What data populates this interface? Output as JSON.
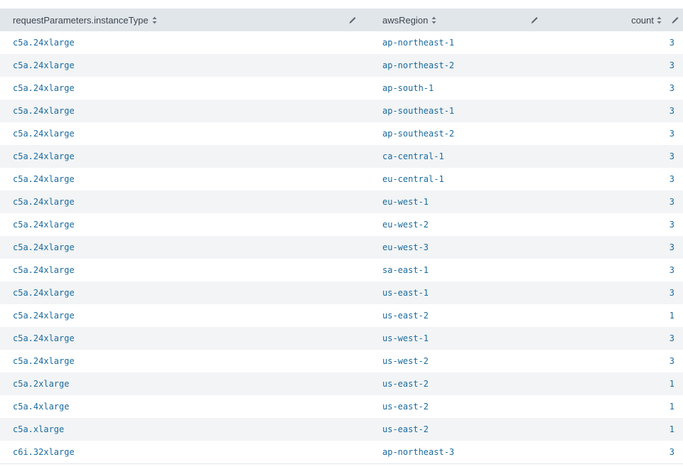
{
  "table": {
    "columns": [
      {
        "label": "requestParameters.instanceType"
      },
      {
        "label": "awsRegion"
      },
      {
        "label": "count"
      }
    ],
    "rows": [
      {
        "instanceType": "c5a.24xlarge",
        "awsRegion": "ap-northeast-1",
        "count": "3"
      },
      {
        "instanceType": "c5a.24xlarge",
        "awsRegion": "ap-northeast-2",
        "count": "3"
      },
      {
        "instanceType": "c5a.24xlarge",
        "awsRegion": "ap-south-1",
        "count": "3"
      },
      {
        "instanceType": "c5a.24xlarge",
        "awsRegion": "ap-southeast-1",
        "count": "3"
      },
      {
        "instanceType": "c5a.24xlarge",
        "awsRegion": "ap-southeast-2",
        "count": "3"
      },
      {
        "instanceType": "c5a.24xlarge",
        "awsRegion": "ca-central-1",
        "count": "3"
      },
      {
        "instanceType": "c5a.24xlarge",
        "awsRegion": "eu-central-1",
        "count": "3"
      },
      {
        "instanceType": "c5a.24xlarge",
        "awsRegion": "eu-west-1",
        "count": "3"
      },
      {
        "instanceType": "c5a.24xlarge",
        "awsRegion": "eu-west-2",
        "count": "3"
      },
      {
        "instanceType": "c5a.24xlarge",
        "awsRegion": "eu-west-3",
        "count": "3"
      },
      {
        "instanceType": "c5a.24xlarge",
        "awsRegion": "sa-east-1",
        "count": "3"
      },
      {
        "instanceType": "c5a.24xlarge",
        "awsRegion": "us-east-1",
        "count": "3"
      },
      {
        "instanceType": "c5a.24xlarge",
        "awsRegion": "us-east-2",
        "count": "1"
      },
      {
        "instanceType": "c5a.24xlarge",
        "awsRegion": "us-west-1",
        "count": "3"
      },
      {
        "instanceType": "c5a.24xlarge",
        "awsRegion": "us-west-2",
        "count": "3"
      },
      {
        "instanceType": "c5a.2xlarge",
        "awsRegion": "us-east-2",
        "count": "1"
      },
      {
        "instanceType": "c5a.4xlarge",
        "awsRegion": "us-east-2",
        "count": "1"
      },
      {
        "instanceType": "c5a.xlarge",
        "awsRegion": "us-east-2",
        "count": "1"
      },
      {
        "instanceType": "c6i.32xlarge",
        "awsRegion": "ap-northeast-3",
        "count": "3"
      }
    ]
  },
  "icons": {
    "sort": "sort-icon",
    "edit": "pencil-icon"
  },
  "colors": {
    "header_bg": "#e1e6eb",
    "stripe_bg": "#f2f4f5",
    "cell_text": "#1a6a9f",
    "header_text": "#3c444d"
  }
}
